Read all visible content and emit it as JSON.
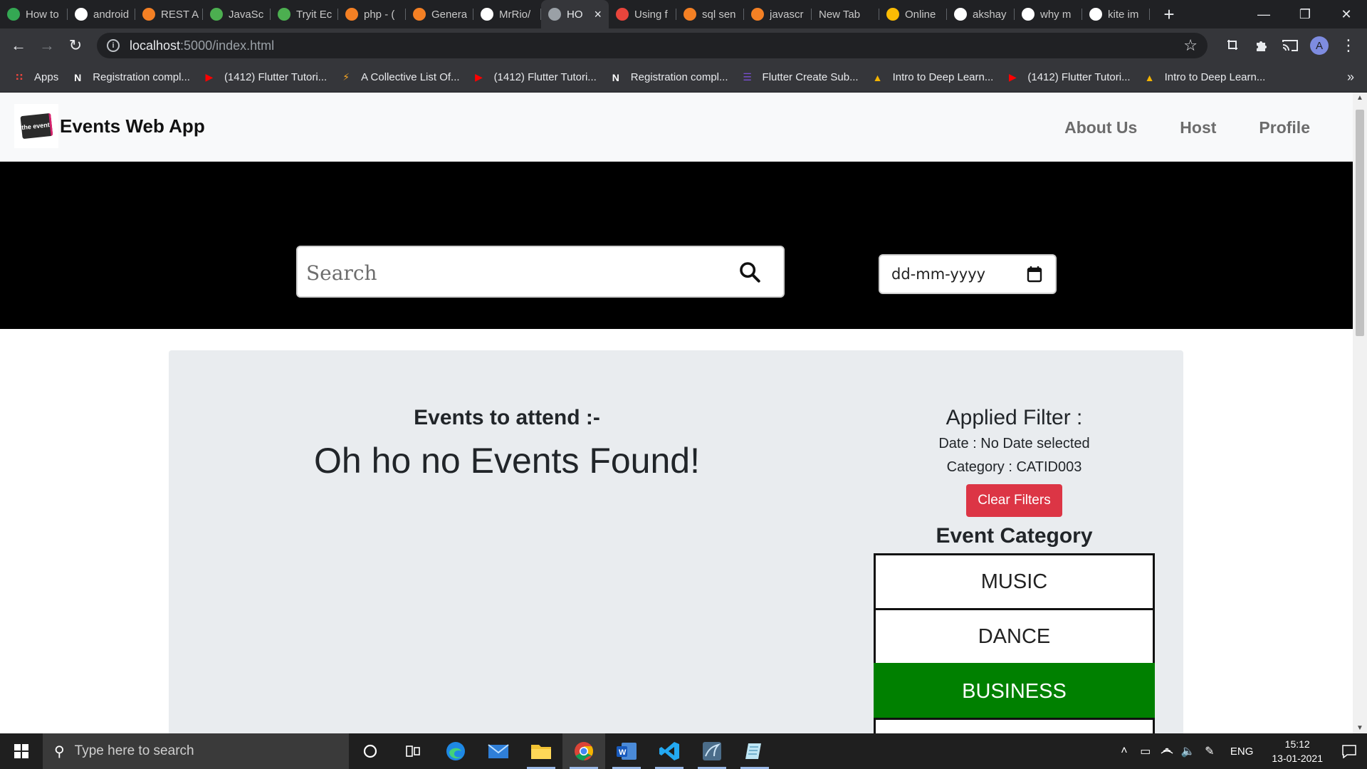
{
  "browser": {
    "tabs": [
      {
        "title": "How to",
        "fav_color": "#34a853",
        "icon": "infinity-icon"
      },
      {
        "title": "android",
        "fav_color": "#ffffff",
        "icon": "google-icon"
      },
      {
        "title": "REST A",
        "fav_color": "#f48024",
        "icon": "stackoverflow-icon"
      },
      {
        "title": "JavaSc",
        "fav_color": "#4caf50",
        "icon": "w3schools-icon"
      },
      {
        "title": "Tryit Ec",
        "fav_color": "#4caf50",
        "icon": "w3schools-icon"
      },
      {
        "title": "php - (",
        "fav_color": "#f48024",
        "icon": "stackoverflow-icon"
      },
      {
        "title": "Genera",
        "fav_color": "#f48024",
        "icon": "stackoverflow-icon"
      },
      {
        "title": "MrRio/",
        "fav_color": "#ffffff",
        "icon": "github-icon"
      },
      {
        "title": "HO",
        "fav_color": "#9aa0a6",
        "icon": "globe-icon",
        "active": true
      },
      {
        "title": "Using f",
        "fav_color": "#e8453c",
        "icon": "gmail-icon"
      },
      {
        "title": "sql sen",
        "fav_color": "#f48024",
        "icon": "stackoverflow-icon"
      },
      {
        "title": "javascr",
        "fav_color": "#f48024",
        "icon": "stackoverflow-icon"
      },
      {
        "title": "New Tab",
        "fav_color": "",
        "icon": ""
      },
      {
        "title": "Online",
        "fav_color": "#fbbc04",
        "icon": "slides-icon"
      },
      {
        "title": "akshay",
        "fav_color": "#ffffff",
        "icon": "github-icon"
      },
      {
        "title": "why m",
        "fav_color": "#ffffff",
        "icon": "google-icon"
      },
      {
        "title": "kite im",
        "fav_color": "#ffffff",
        "icon": "google-icon"
      }
    ],
    "url_host": "localhost",
    "url_path": ":5000/index.html",
    "profile_initial": "A",
    "bookmarks": [
      {
        "label": "Apps",
        "icon": "apps-grid-icon",
        "color": "#e8453c"
      },
      {
        "label": "Registration compl...",
        "icon": "notion-icon",
        "color": "#ffffff"
      },
      {
        "label": "(1412) Flutter Tutori...",
        "icon": "youtube-icon",
        "color": "#ff0000"
      },
      {
        "label": "A Collective List Of...",
        "icon": "bolt-icon",
        "color": "#f6a623"
      },
      {
        "label": "(1412) Flutter Tutori...",
        "icon": "youtube-icon",
        "color": "#ff0000"
      },
      {
        "label": "Registration compl...",
        "icon": "notion-icon",
        "color": "#ffffff"
      },
      {
        "label": "Flutter Create Sub...",
        "icon": "list-icon",
        "color": "#7b4fd6"
      },
      {
        "label": "Intro to Deep Learn...",
        "icon": "flame-icon",
        "color": "#f4b400"
      },
      {
        "label": "(1412) Flutter Tutori...",
        "icon": "youtube-icon",
        "color": "#ff0000"
      },
      {
        "label": "Intro to Deep Learn...",
        "icon": "flame-icon",
        "color": "#f4b400"
      }
    ]
  },
  "page": {
    "brand_name": "Events Web App",
    "logo_text": "the event",
    "nav": [
      "About Us",
      "Host",
      "Profile"
    ],
    "search_placeholder": "Search",
    "date_placeholder": "dd-mm-yyyy",
    "events_title": "Events to attend :-",
    "empty_message": "Oh ho no Events Found!",
    "filter": {
      "title": "Applied Filter :",
      "date_line": "Date : No Date selected",
      "category_line": "Category : CATID003",
      "clear_label": "Clear Filters"
    },
    "category_title": "Event Category",
    "categories": [
      {
        "label": "MUSIC",
        "active": false
      },
      {
        "label": "DANCE",
        "active": false
      },
      {
        "label": "BUSINESS",
        "active": true
      }
    ],
    "colors": {
      "active_category": "#008000",
      "clear_button": "#dc3545",
      "hero": "#000000"
    }
  },
  "taskbar": {
    "search_placeholder": "Type here to search",
    "apps": [
      "cortana-icon",
      "task-view-icon",
      "edge-icon",
      "mail-icon",
      "file-explorer-icon",
      "chrome-icon",
      "word-icon",
      "vscode-icon",
      "mysql-workbench-icon",
      "notepad-icon"
    ],
    "language": "ENG",
    "time": "15:12",
    "date": "13-01-2021"
  }
}
